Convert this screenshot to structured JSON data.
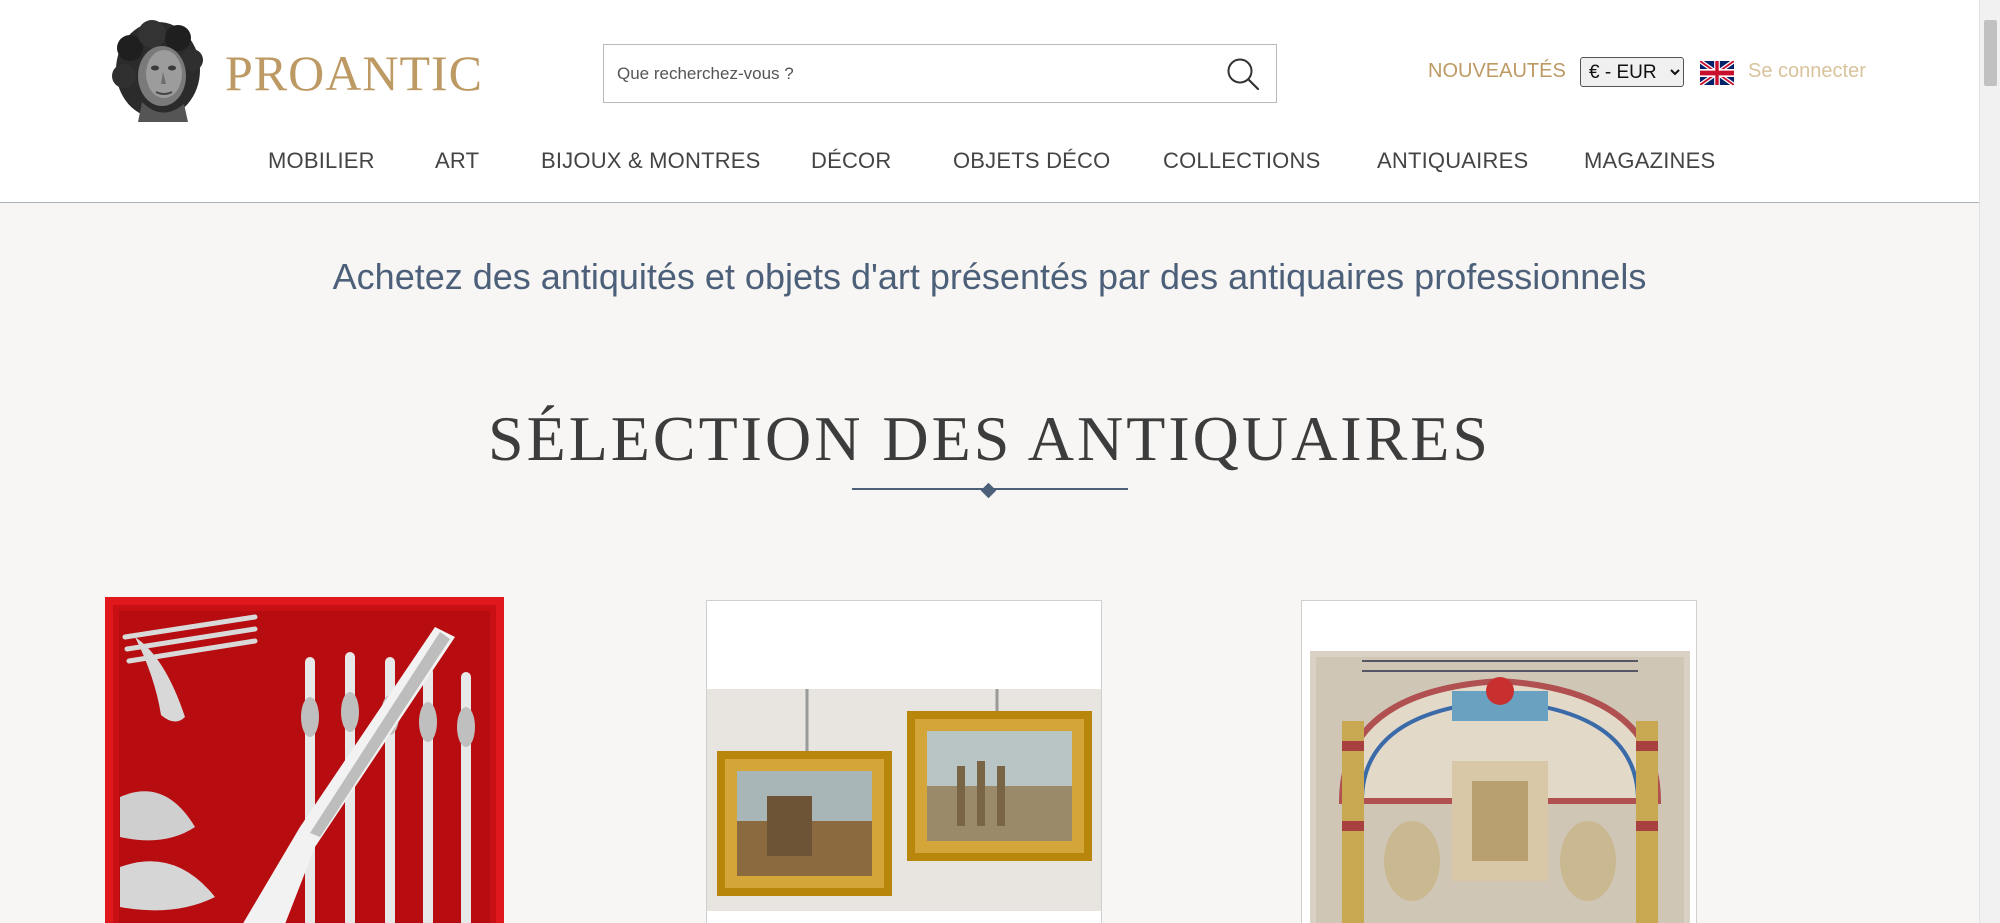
{
  "header": {
    "logo_text": "PROANTIC",
    "logo_icon": "bust-icon",
    "search": {
      "placeholder": "Que recherchez-vous ?",
      "value": "",
      "icon": "search-icon"
    },
    "new_label": "NOUVEAUTÉS",
    "currency": {
      "selected": "€ - EUR",
      "options": [
        "€ - EUR"
      ]
    },
    "language_flag": "uk-flag-icon",
    "login_label": "Se connecter"
  },
  "nav": {
    "items": [
      {
        "label": "MOBILIER"
      },
      {
        "label": "ART"
      },
      {
        "label": "BIJOUX & MONTRES"
      },
      {
        "label": "DÉCOR"
      },
      {
        "label": "OBJETS DÉCO"
      },
      {
        "label": "COLLECTIONS"
      },
      {
        "label": "ANTIQUAIRES"
      },
      {
        "label": "MAGAZINES"
      }
    ]
  },
  "main": {
    "tagline": "Achetez des antiquités et objets d'art présentés par des antiquaires professionnels",
    "section_title": "SÉLECTION DES ANTIQUAIRES",
    "cards": [
      {
        "image": "silver-cutlery-set-image"
      },
      {
        "image": "gilt-framed-paintings-image"
      },
      {
        "image": "embroidered-tapestry-image"
      }
    ]
  },
  "colors": {
    "brand_gold": "#bd9a63",
    "login_gold": "#d8c39c",
    "slate_blue": "#4d607a",
    "page_bg": "#f7f6f4",
    "card_red": "#e0181b"
  }
}
